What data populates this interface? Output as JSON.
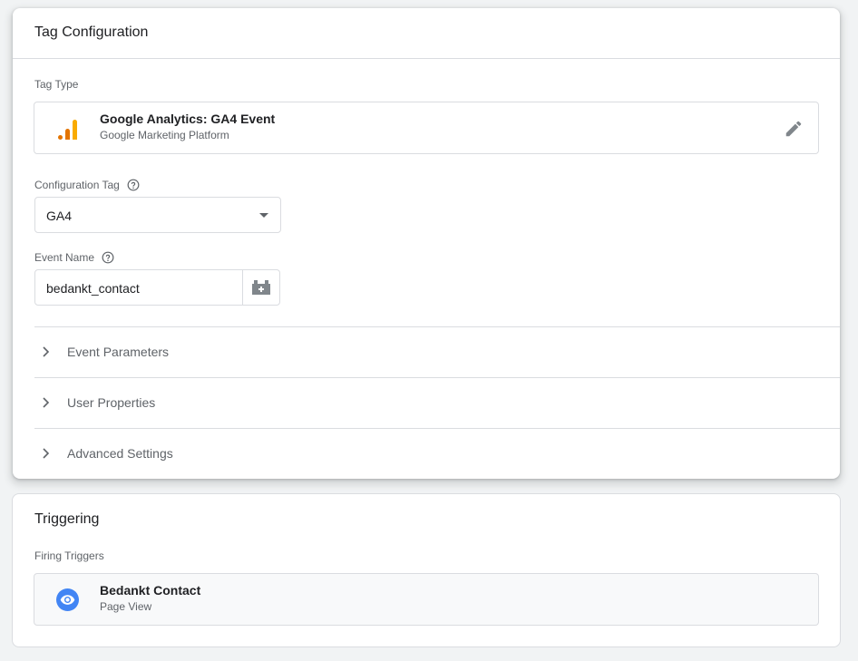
{
  "tag_config": {
    "title": "Tag Configuration",
    "tag_type_label": "Tag Type",
    "tag_type": {
      "name": "Google Analytics: GA4 Event",
      "vendor": "Google Marketing Platform",
      "icon": "google-analytics-icon"
    },
    "config_tag": {
      "label": "Configuration Tag",
      "value": "GA4"
    },
    "event_name": {
      "label": "Event Name",
      "value": "bedankt_contact"
    },
    "sections": [
      {
        "label": "Event Parameters"
      },
      {
        "label": "User Properties"
      },
      {
        "label": "Advanced Settings"
      }
    ]
  },
  "triggering": {
    "title": "Triggering",
    "firing_label": "Firing Triggers",
    "trigger": {
      "name": "Bedankt Contact",
      "type": "Page View",
      "icon": "eye-icon",
      "color": "#4285f4"
    }
  },
  "colors": {
    "analytics_orange": "#f9ab00",
    "analytics_dark_orange": "#e37400",
    "trigger_blue": "#4285f4"
  }
}
